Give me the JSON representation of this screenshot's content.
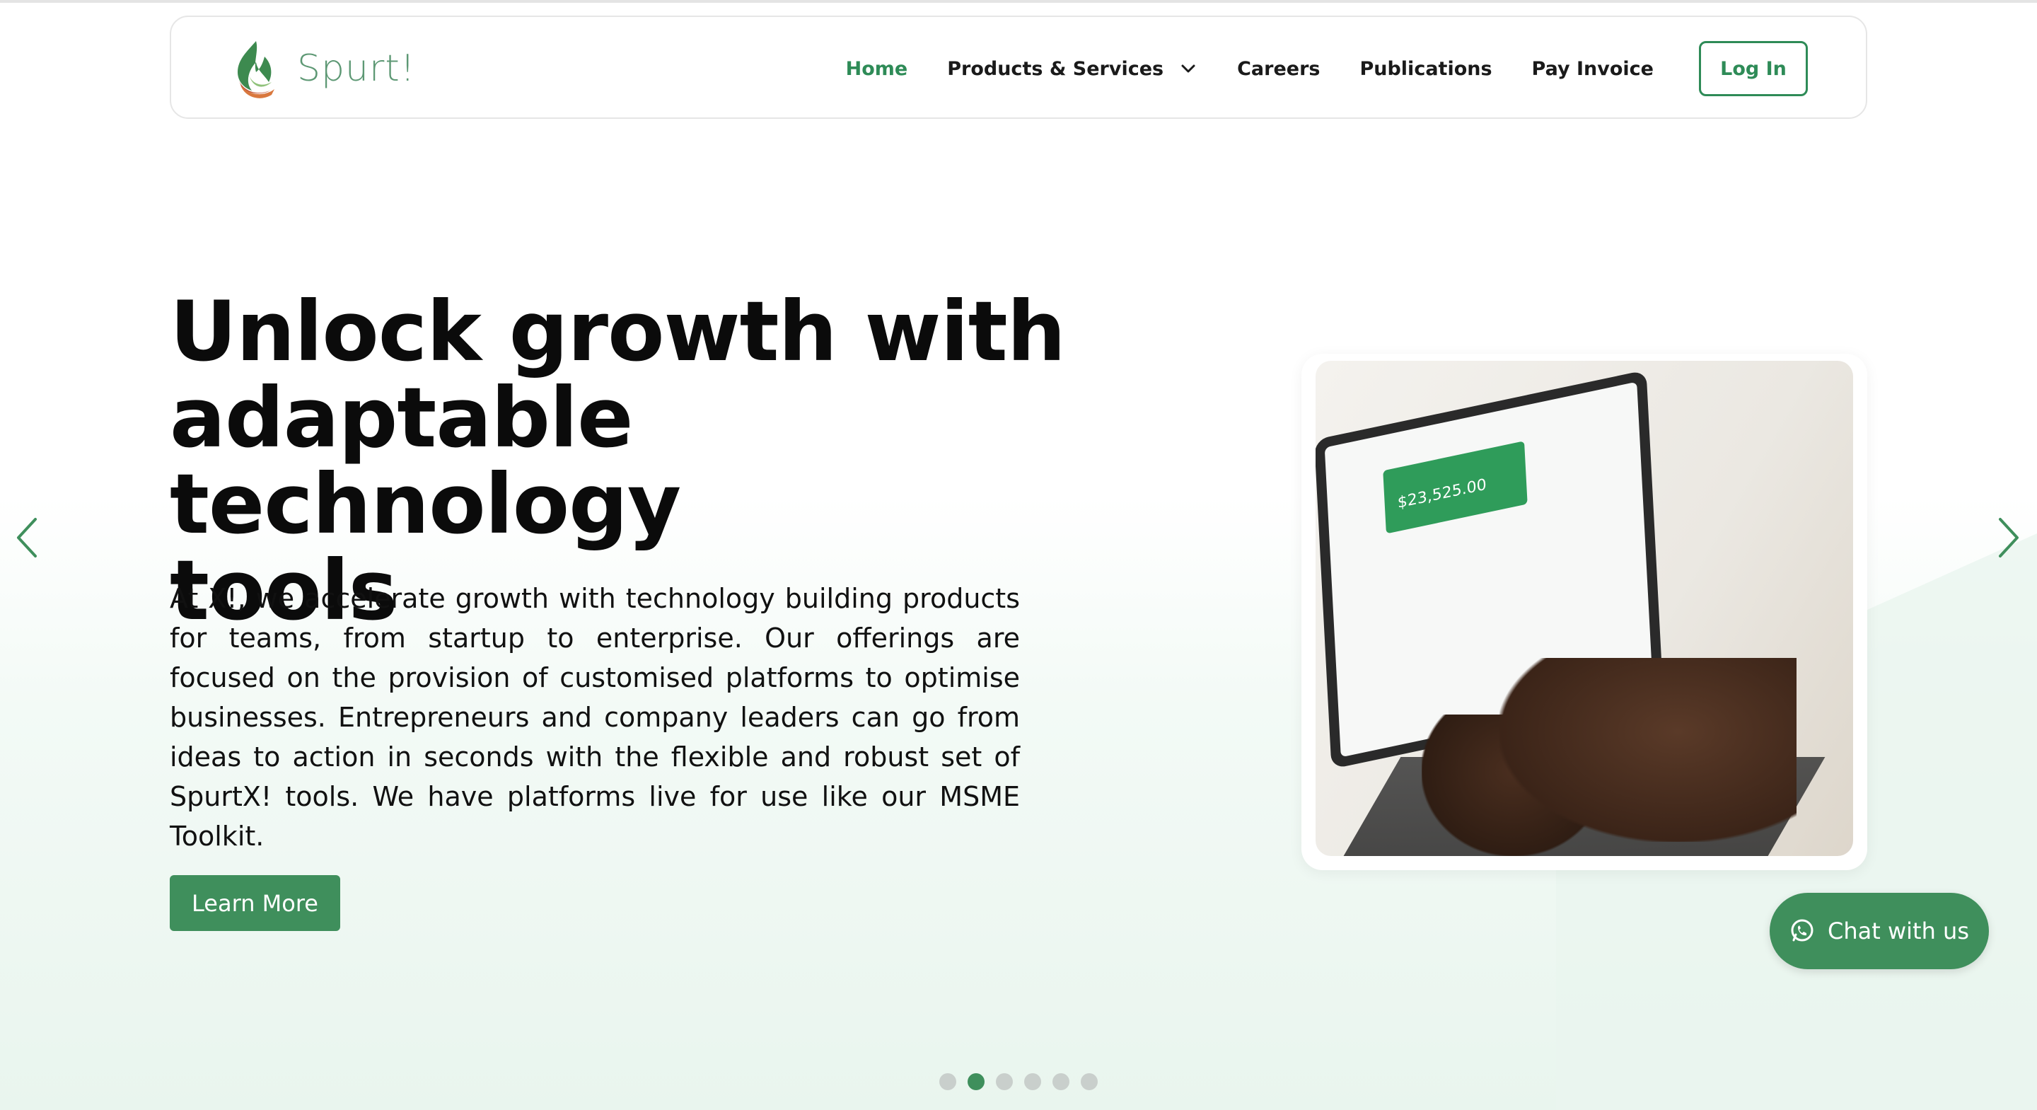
{
  "brand": {
    "name": "Spurt!",
    "logo_icon": "spurt-flame-logo",
    "accent_color": "#2e8b57"
  },
  "nav": {
    "items": [
      {
        "label": "Home",
        "active": true
      },
      {
        "label": "Products & Services",
        "active": false,
        "dropdown": true
      },
      {
        "label": "Careers",
        "active": false
      },
      {
        "label": "Publications",
        "active": false
      },
      {
        "label": "Pay Invoice",
        "active": false
      }
    ],
    "login_label": "Log In"
  },
  "hero": {
    "title_lines": [
      "Unlock growth with",
      "adaptable technology",
      "tools"
    ],
    "body": "At X!, we accelerate growth with technology building products for teams, from startup to enterprise. Our offerings are focused on the provision of customised platforms to optimise businesses. Entrepreneurs and company leaders can go from ideas to action in seconds with the flexible and robust set of SpurtX! tools. We have platforms live for use like our MSME Toolkit.",
    "cta_label": "Learn More"
  },
  "image": {
    "description_icon": "laptop-dashboard-photo",
    "dashboard_amount": "$23,525.00"
  },
  "chat": {
    "label": "Chat with us",
    "icon": "whatsapp-icon"
  },
  "carousel": {
    "slide_count": 6,
    "active_index": 1,
    "prev_icon": "chevron-left-icon",
    "next_icon": "chevron-right-icon"
  }
}
